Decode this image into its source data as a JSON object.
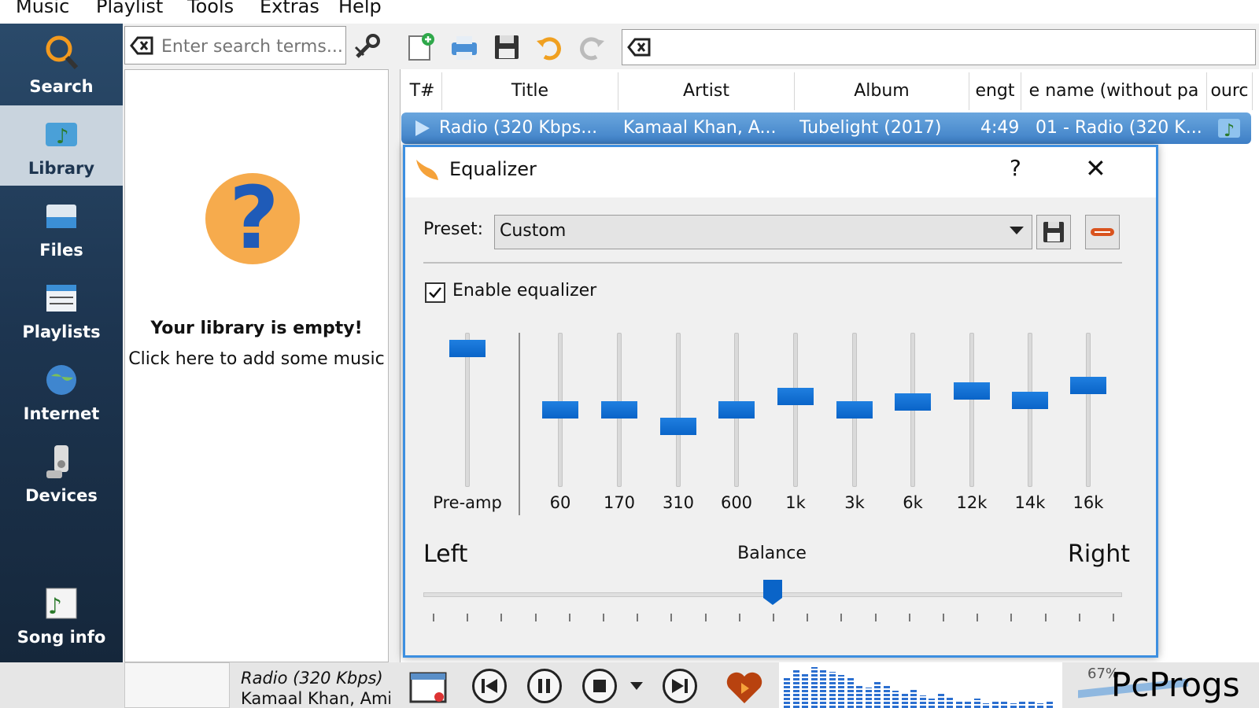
{
  "menu": [
    "Music",
    "Playlist",
    "Tools",
    "Extras",
    "Help"
  ],
  "nav": [
    {
      "label": "Search",
      "icon": "magnifier-icon"
    },
    {
      "label": "Library",
      "icon": "library-icon",
      "active": true
    },
    {
      "label": "Files",
      "icon": "files-icon"
    },
    {
      "label": "Playlists",
      "icon": "playlists-icon"
    },
    {
      "label": "Internet",
      "icon": "globe-icon"
    },
    {
      "label": "Devices",
      "icon": "devices-icon"
    },
    {
      "label": "Song info",
      "icon": "song-info-icon"
    }
  ],
  "library": {
    "search_placeholder": "Enter search terms...",
    "empty_title": "Your library is empty!",
    "empty_hint": "Click here to add some music"
  },
  "playlist": {
    "columns": [
      "T#",
      "Title",
      "Artist",
      "Album",
      "engt",
      "e name (without pa",
      "ourc"
    ],
    "rows": [
      {
        "title": "Radio (320 Kbps...",
        "artist": "Kamaal Khan, A...",
        "album": "Tubelight (2017)",
        "length": "4:49",
        "filename": "01 - Radio (320 K..."
      }
    ]
  },
  "equalizer": {
    "title": "Equalizer",
    "help": "?",
    "close": "✕",
    "preset_label": "Preset:",
    "preset_value": "Custom",
    "enable_label": "Enable equalizer",
    "enabled": true,
    "preamp": {
      "label": "Pre-amp",
      "level": 0.95
    },
    "bands": [
      {
        "label": "60",
        "level": 0.5
      },
      {
        "label": "170",
        "level": 0.5
      },
      {
        "label": "310",
        "level": 0.38
      },
      {
        "label": "600",
        "level": 0.5
      },
      {
        "label": "1k",
        "level": 0.6
      },
      {
        "label": "3k",
        "level": 0.5
      },
      {
        "label": "6k",
        "level": 0.56
      },
      {
        "label": "12k",
        "level": 0.64
      },
      {
        "label": "14k",
        "level": 0.57
      },
      {
        "label": "16k",
        "level": 0.68
      }
    ],
    "balance": {
      "left": "Left",
      "right": "Right",
      "title": "Balance",
      "value": 0.5
    }
  },
  "now_playing": {
    "title": "Radio (320 Kbps)",
    "artist": "Kamaal Khan, Ami"
  },
  "volume_text": "67%",
  "watermark": "PcProgs",
  "colors": {
    "accent": "#0a64c8",
    "nav": "#1d3550",
    "selection": "#3d7fc6"
  }
}
